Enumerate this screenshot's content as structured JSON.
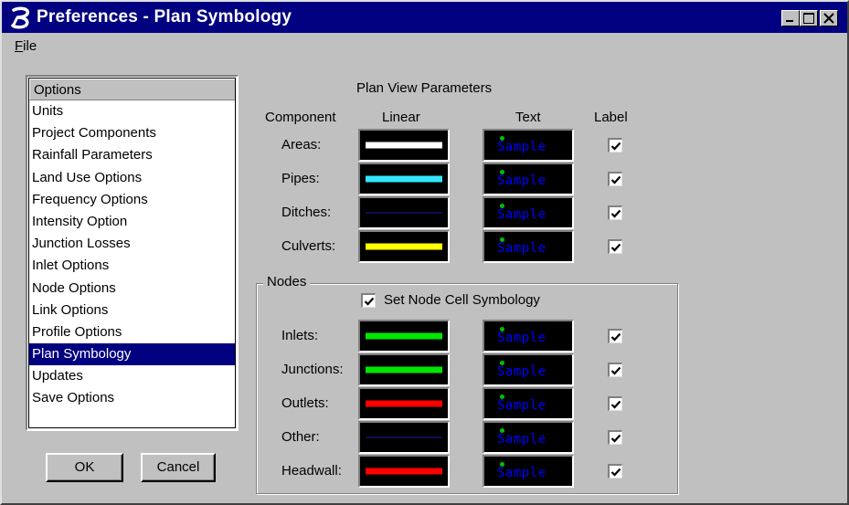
{
  "window": {
    "title": "Preferences - Plan Symbology"
  },
  "menu": {
    "file": "File"
  },
  "options_list": {
    "header": "Options",
    "items": [
      "Units",
      "Project Components",
      "Rainfall Parameters",
      "Land Use Options",
      "Frequency Options",
      "Intensity Option",
      "Junction Losses",
      "Inlet Options",
      "Node Options",
      "Link Options",
      "Profile Options",
      "Plan Symbology",
      "Updates",
      "Save Options"
    ],
    "selected": "Plan Symbology"
  },
  "buttons": {
    "ok": "OK",
    "cancel": "Cancel"
  },
  "plan_view": {
    "heading": "Plan View Parameters",
    "col_component": "Component",
    "col_linear": "Linear",
    "col_text": "Text",
    "col_label": "Label",
    "sample_text": "Sample",
    "rows": [
      {
        "label": "Areas:",
        "line_color": "#ffffff",
        "thick": true,
        "checked": true
      },
      {
        "label": "Pipes:",
        "line_color": "#33e5ff",
        "thick": true,
        "checked": true
      },
      {
        "label": "Ditches:",
        "line_color": "#1a1aa8",
        "thick": false,
        "checked": true
      },
      {
        "label": "Culverts:",
        "line_color": "#ffff00",
        "thick": true,
        "checked": true
      }
    ]
  },
  "nodes": {
    "group_label": "Nodes",
    "set_node_label": "Set Node Cell Symbology",
    "set_node_checked": true,
    "rows": [
      {
        "label": "Inlets:",
        "line_color": "#00e600",
        "thick": true,
        "checked": true
      },
      {
        "label": "Junctions:",
        "line_color": "#00e600",
        "thick": true,
        "checked": true
      },
      {
        "label": "Outlets:",
        "line_color": "#ff0000",
        "thick": true,
        "checked": true
      },
      {
        "label": "Other:",
        "line_color": "#1a1aa8",
        "thick": false,
        "checked": true
      },
      {
        "label": "Headwall:",
        "line_color": "#ff0000",
        "thick": true,
        "checked": true
      }
    ]
  },
  "colors": {
    "titlebar": "#000080",
    "dialog_bg": "#c0c0c0",
    "selection": "#000080"
  }
}
